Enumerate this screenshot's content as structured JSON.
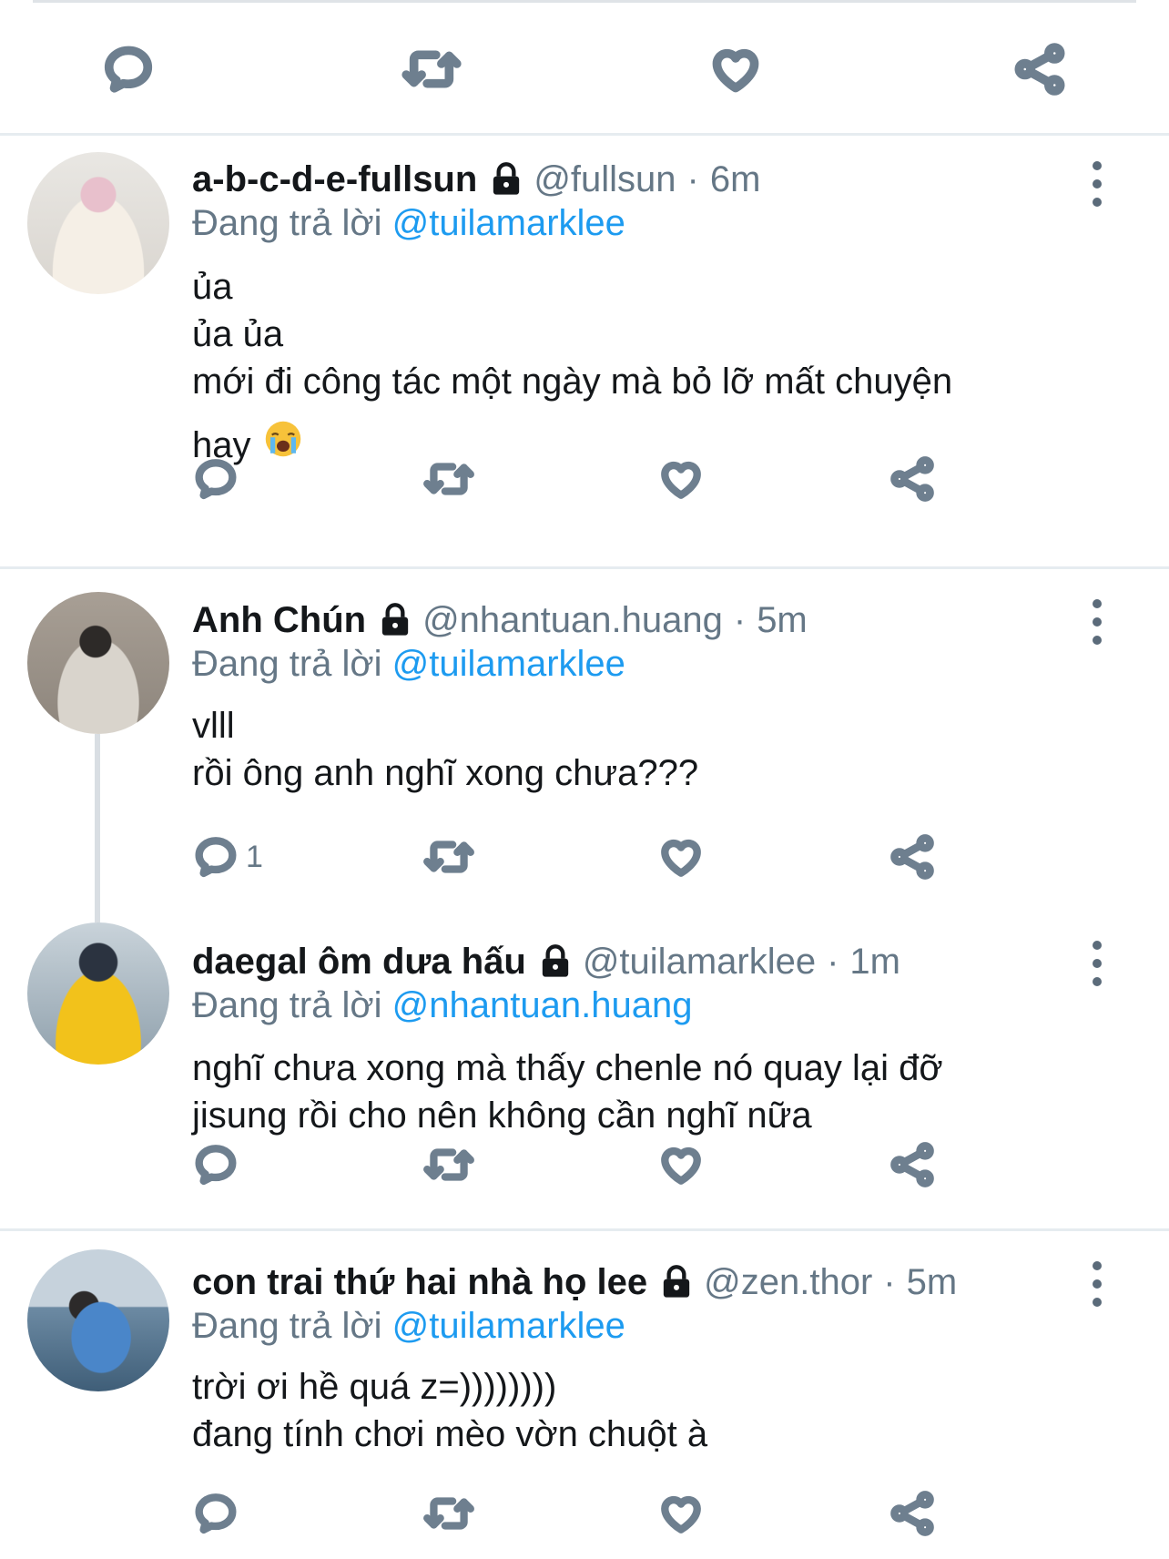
{
  "top_actions": {
    "reply": "reply",
    "retweet": "retweet",
    "like": "like",
    "share": "share"
  },
  "reply_prefix": "Đang trả lời",
  "tweets": [
    {
      "name": "a-b-c-d-e-fullsun",
      "handle": "@fullsun",
      "time": "6m",
      "reply_to": "@tuilamarklee",
      "lines": [
        "ủa",
        "ủa ủa",
        "mới đi công tác một ngày mà bỏ lỡ mất chuyện",
        "hay"
      ],
      "emoji": "loudly-crying-face",
      "reply_count": ""
    },
    {
      "name": "Anh Chún",
      "handle": "@nhantuan.huang",
      "time": "5m",
      "reply_to": "@tuilamarklee",
      "lines": [
        "vlll",
        "rồi ông anh nghĩ xong chưa???"
      ],
      "reply_count": "1"
    },
    {
      "name": "daegal ôm dưa hấu",
      "handle": "@tuilamarklee",
      "time": "1m",
      "reply_to": "@nhantuan.huang",
      "lines": [
        "nghĩ chưa xong mà thấy chenle nó quay lại đỡ",
        "jisung rồi cho nên không cần nghĩ nữa"
      ],
      "reply_count": ""
    },
    {
      "name": "con trai thứ hai nhà họ lee",
      "handle": "@zen.thor",
      "time": "5m",
      "reply_to": "@tuilamarklee",
      "lines": [
        "trời ơi hề quá z=))))))))",
        "đang tính chơi mèo vờn chuột à"
      ],
      "reply_count": ""
    }
  ],
  "separator": "·",
  "colors": {
    "mention": "#1d9bf0",
    "muted": "#657786",
    "text": "#14171a",
    "icon": "#6e7f8f"
  }
}
